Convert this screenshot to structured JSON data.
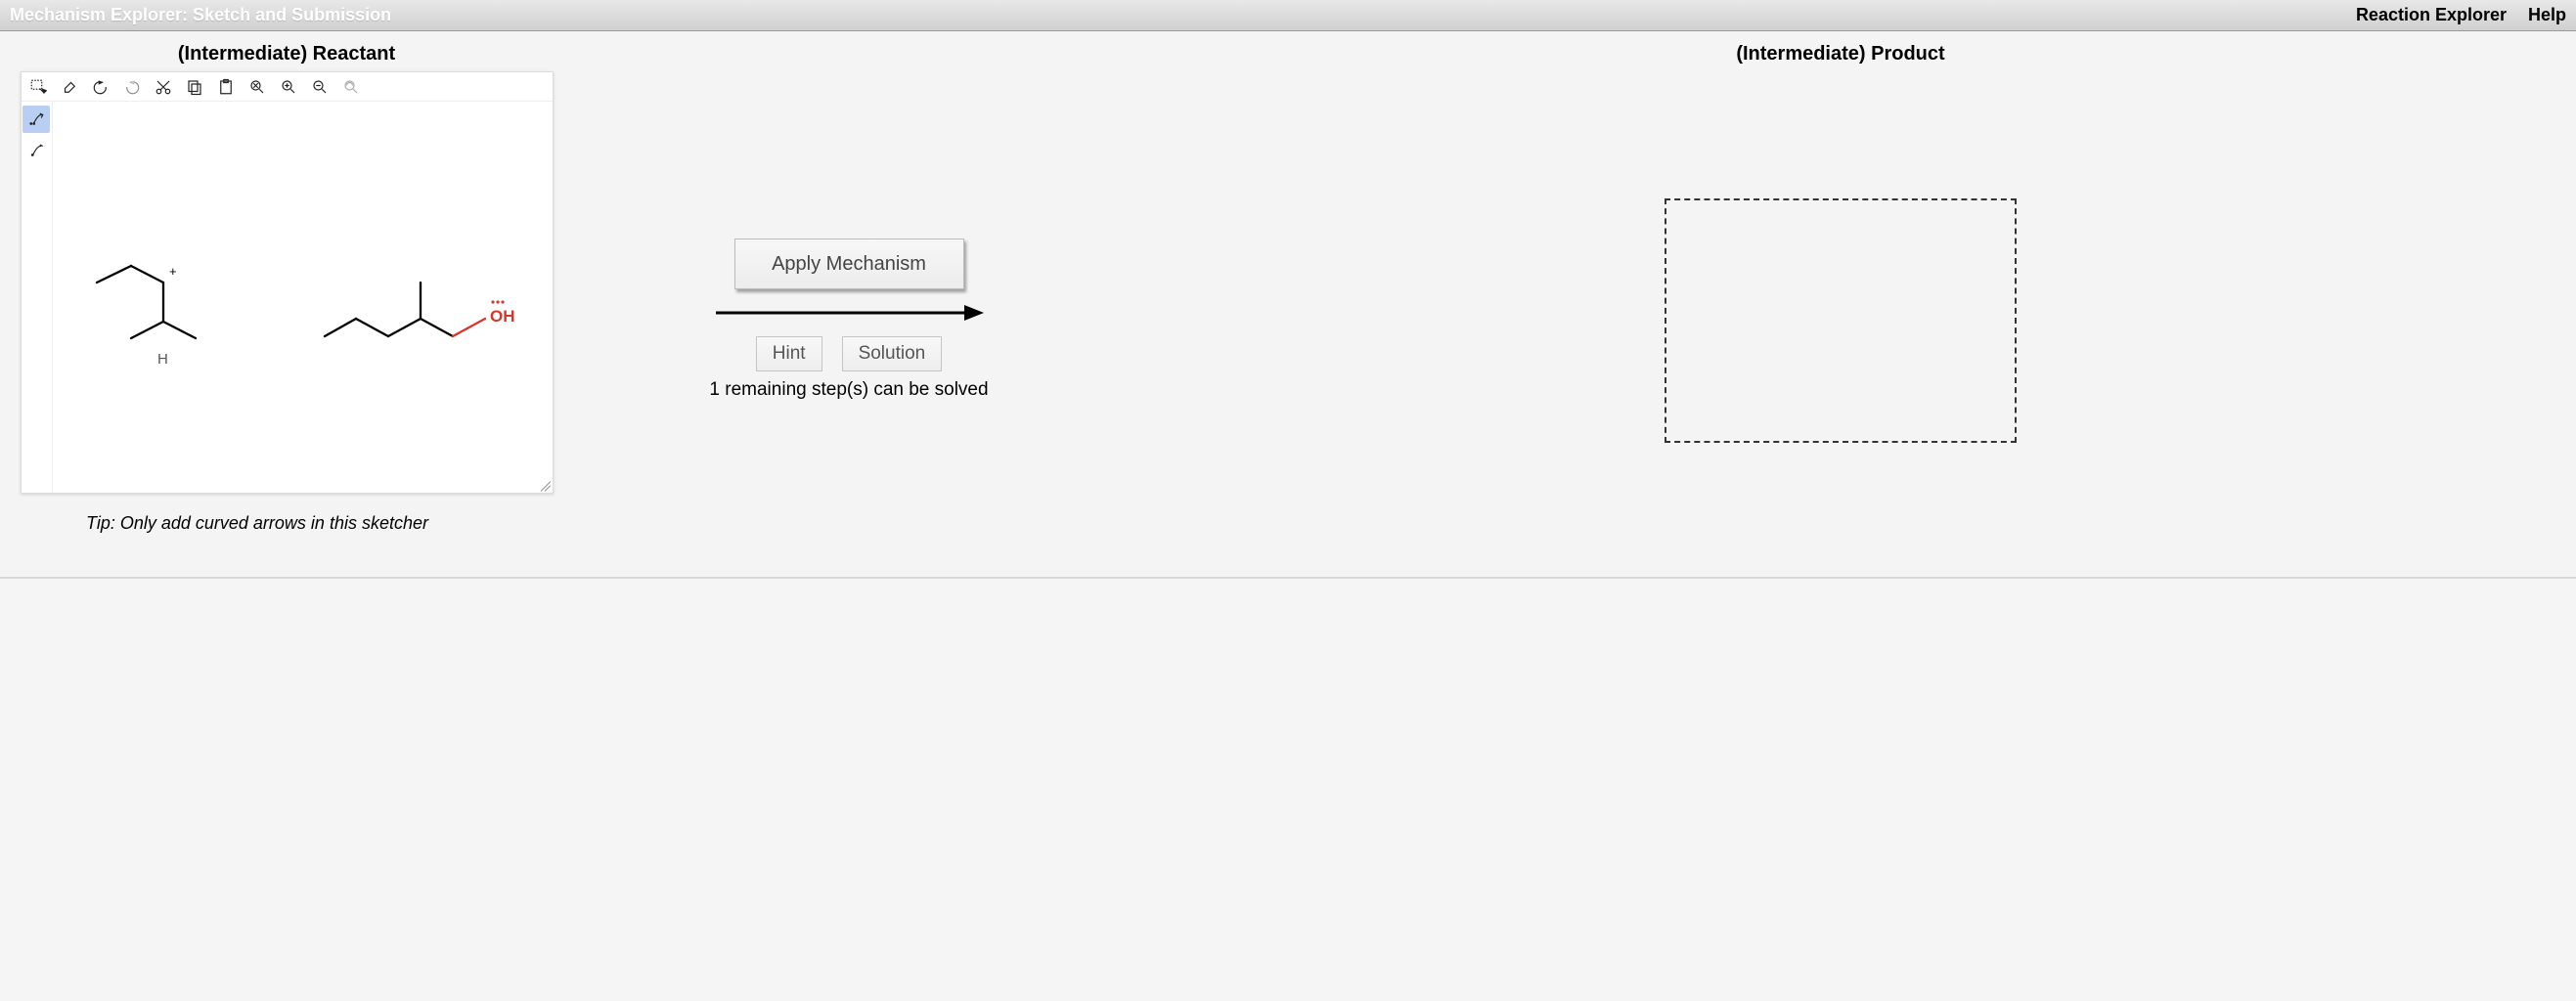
{
  "header": {
    "title": "Mechanism Explorer: Sketch and Submission",
    "links": {
      "reaction_explorer": "Reaction Explorer",
      "help": "Help"
    }
  },
  "columns": {
    "reactant_heading": "(Intermediate) Reactant",
    "product_heading": "(Intermediate) Product"
  },
  "controls": {
    "apply_label": "Apply Mechanism",
    "hint_label": "Hint",
    "solution_label": "Solution",
    "remaining_text": "1 remaining step(s) can be solved"
  },
  "tip": "Tip: Only add curved arrows in this sketcher",
  "sketcher": {
    "top_tools": [
      "marquee-select",
      "erase",
      "undo",
      "redo",
      "cut",
      "copy",
      "paste",
      "zoom-reset",
      "zoom-in",
      "zoom-out",
      "zoom-fit"
    ],
    "side_tools": [
      "curved-arrow-double",
      "curved-arrow-single"
    ],
    "selected_side_tool": "curved-arrow-double",
    "molecule_annotations": {
      "left_charge": "+",
      "left_atom": "H",
      "right_label": "OH"
    },
    "colors": {
      "oh_label": "#d9362a",
      "oh_bond": "#d9362a"
    }
  }
}
